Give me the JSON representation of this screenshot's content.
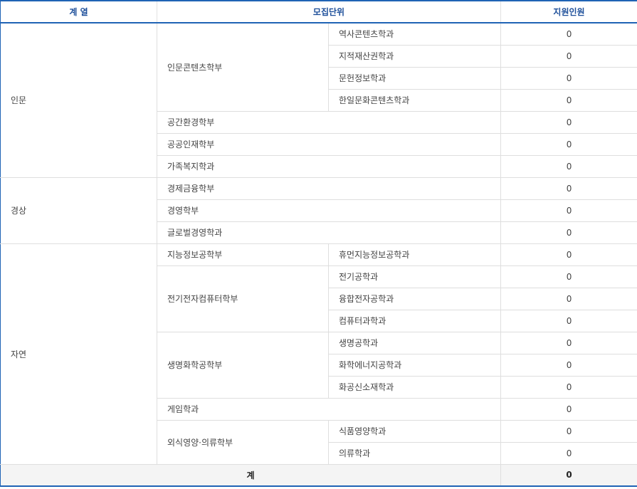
{
  "header": {
    "col1": "계 열",
    "col2": "모집단위",
    "col3": "지원인원"
  },
  "groups": {
    "inmun": "인문",
    "gyeongsang": "경상",
    "jayeon": "자연"
  },
  "units": {
    "inmun_content": "인문콘텐츠학부",
    "space_env": "공간환경학부",
    "public_talent": "공공인재학부",
    "family_welfare": "가족복지학과",
    "econ_finance": "경제금융학부",
    "business": "경영학부",
    "global_business": "글로벌경영학과",
    "intel_info": "지능정보공학부",
    "elec_computer": "전기전자컴퓨터학부",
    "bio_chem": "생명화학공학부",
    "game": "게임학과",
    "food_nutrition": "외식영양·의류학부"
  },
  "majors": {
    "history_content": "역사콘텐츠학과",
    "ip": "지적재산권학과",
    "lib_info": "문헌정보학과",
    "korea_japan": "한일문화콘텐츠학과",
    "human_intel": "휴먼지능정보공학과",
    "electrical": "전기공학과",
    "convergence_elec": "융합전자공학과",
    "computer": "컴퓨터과학과",
    "bio": "생명공학과",
    "chem_energy": "화학에너지공학과",
    "chem_material": "화공신소재학과",
    "food": "식품영양학과",
    "clothing": "의류학과"
  },
  "counts": {
    "history_content": "0",
    "ip": "0",
    "lib_info": "0",
    "korea_japan": "0",
    "space_env": "0",
    "public_talent": "0",
    "family_welfare": "0",
    "econ_finance": "0",
    "business": "0",
    "global_business": "0",
    "human_intel": "0",
    "electrical": "0",
    "convergence_elec": "0",
    "computer": "0",
    "bio": "0",
    "chem_energy": "0",
    "chem_material": "0",
    "game": "0",
    "food": "0",
    "clothing": "0"
  },
  "total": {
    "label": "계",
    "value": "0"
  }
}
